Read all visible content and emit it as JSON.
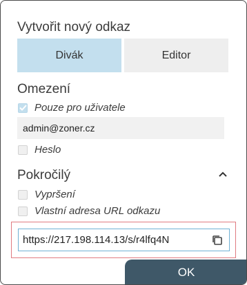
{
  "dialog": {
    "title": "Vytvořit nový odkaz"
  },
  "tabs": [
    {
      "label": "Divák",
      "active": true
    },
    {
      "label": "Editor",
      "active": false
    }
  ],
  "restrictions": {
    "title": "Omezení",
    "users_only": {
      "label": "Pouze pro uživatele",
      "checked": true
    },
    "email_value": "admin@zoner.cz",
    "password": {
      "label": "Heslo",
      "checked": false
    }
  },
  "advanced": {
    "title": "Pokročilý",
    "expiry": {
      "label": "Vypršení",
      "checked": false
    },
    "custom_url": {
      "label": "Vlastní adresa URL odkazu",
      "checked": false
    }
  },
  "link": {
    "url": "https://217.198.114.13/s/r4lfq4N"
  },
  "footer": {
    "ok_label": "OK"
  },
  "colors": {
    "accent_light": "#c3dfee",
    "ok_button": "#3f5868",
    "highlight_border": "#e07a80"
  }
}
